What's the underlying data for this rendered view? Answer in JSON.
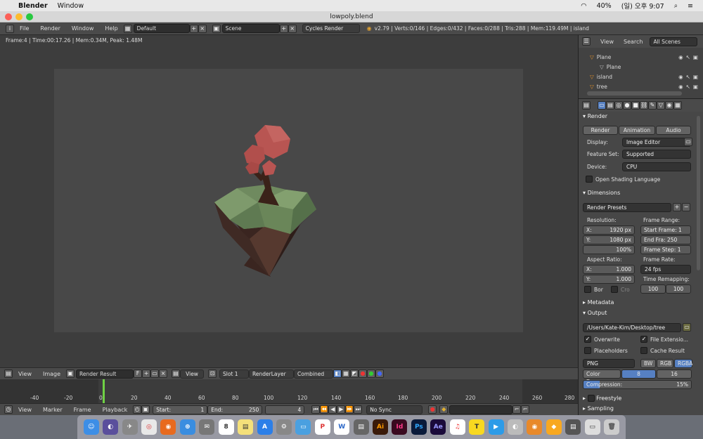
{
  "mac": {
    "app": "Blender",
    "menu": "Window",
    "battery": "40%",
    "clock": "(일) 오후 9:07"
  },
  "window": {
    "title": "lowpoly.blend"
  },
  "info": {
    "menus": [
      "File",
      "Render",
      "Window",
      "Help"
    ],
    "layout": "Default",
    "scene": "Scene",
    "engine": "Cycles Render",
    "stats": "v2.79 | Verts:0/146 | Edges:0/432 | Faces:0/288 | Tris:288 | Mem:119.49M | island"
  },
  "viewport": {
    "status": "Frame:4 | Time:00:17.26 | Mem:0.34M, Peak: 1.48M"
  },
  "image_header": {
    "view": "View",
    "image": "Image",
    "image_name": "Render Result",
    "f": "F",
    "view2": "View",
    "slot": "Slot 1",
    "layer": "RenderLayer",
    "pass": "Combined"
  },
  "timeline": {
    "ticks": [
      "-40",
      "-20",
      "0",
      "20",
      "40",
      "60",
      "80",
      "100",
      "120",
      "140",
      "160",
      "180",
      "200",
      "220",
      "240",
      "260",
      "280"
    ],
    "current": 4
  },
  "timeline_header": {
    "view": "View",
    "marker": "Marker",
    "frame": "Frame",
    "playback": "Playback",
    "start_label": "Start:",
    "start": "1",
    "end_label": "End:",
    "end": "250",
    "current": "4",
    "sync": "No Sync"
  },
  "outliner": {
    "tabs": [
      "View",
      "Search",
      "All Scenes"
    ],
    "items": [
      "Plane",
      "Plane",
      "island",
      "tree"
    ]
  },
  "props": {
    "render_section": "Render",
    "render_buttons": [
      "Render",
      "Animation",
      "Audio"
    ],
    "display_label": "Display:",
    "display": "Image Editor",
    "feature_label": "Feature Set:",
    "feature": "Supported",
    "device_label": "Device:",
    "device": "CPU",
    "osl": "Open Shading Language",
    "dimensions": "Dimensions",
    "presets": "Render Presets",
    "resolution": "Resolution:",
    "res_x": "1920 px",
    "res_y": "1080 px",
    "res_pct": "100%",
    "frame_range": "Frame Range:",
    "start_frame": "Start Frame: 1",
    "end_frame": "End Fra:  250",
    "frame_step": "Frame Step: 1",
    "aspect": "Aspect Ratio:",
    "asp_x": "1.000",
    "asp_y": "1.000",
    "frame_rate": "Frame Rate:",
    "fps": "24 fps",
    "remap": "Time Remapping:",
    "remap_old": "100",
    "remap_new": "100",
    "border": "Bor",
    "crop": "Cro",
    "metadata": "Metadata",
    "output": "Output",
    "path": "/Users/Kate-Kim/Desktop/tree",
    "overwrite": "Overwrite",
    "file_ext": "File Extensio...",
    "placeholders": "Placeholders",
    "cache": "Cache Result",
    "format": "PNG",
    "bw": "BW",
    "rgb": "RGB",
    "rgba": "RGBA",
    "color_depth": "Color Dep...",
    "depth8": "8",
    "depth16": "16",
    "compression": "Compression:",
    "compression_val": "15%",
    "freestyle": "Freestyle",
    "sampling": "Sampling"
  },
  "colors": {
    "accent": "#5680c2",
    "playhead": "#6fd144",
    "mac_apple": "#111"
  }
}
